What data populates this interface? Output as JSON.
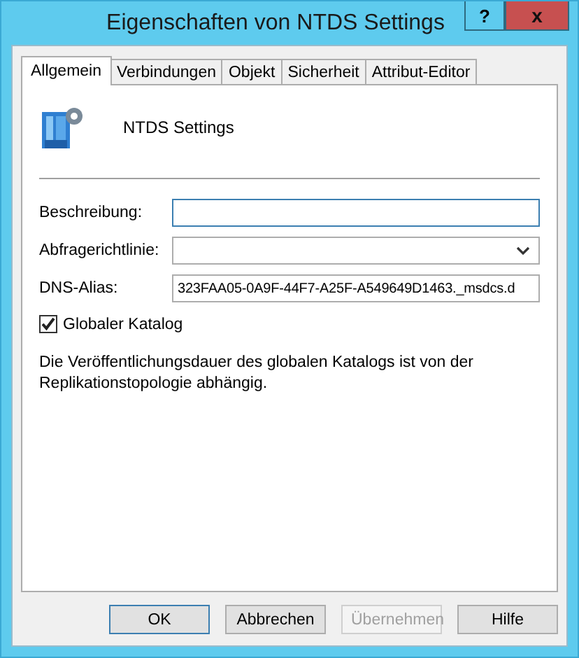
{
  "window": {
    "title": "Eigenschaften von NTDS Settings",
    "help": "?",
    "close": "x"
  },
  "tabs": [
    {
      "label": "Allgemein",
      "selected": true
    },
    {
      "label": "Verbindungen",
      "selected": false
    },
    {
      "label": "Objekt",
      "selected": false
    },
    {
      "label": "Sicherheit",
      "selected": false
    },
    {
      "label": "Attribut-Editor",
      "selected": false
    }
  ],
  "header": {
    "name": "NTDS Settings"
  },
  "fields": [
    {
      "kind": "text",
      "label": "Beschreibung:"
    },
    {
      "kind": "dropdown",
      "label": "Abfragerichtlinie:"
    },
    {
      "kind": "text",
      "label": "DNS-Alias:",
      "value": "323FAA05-0A9F-44F7-A25F-A549649D1463._msdcs.d"
    }
  ],
  "checkbox": {
    "label": "Globaler Katalog",
    "checked": true
  },
  "note": "Die Veröffentlichungsdauer des globalen Katalogs ist von der Replikationstopologie abhängig.",
  "buttons": [
    {
      "label": "OK",
      "disabled": false,
      "default": true
    },
    {
      "label": "Abbrechen",
      "disabled": false,
      "default": false
    },
    {
      "label": "Übernehmen",
      "disabled": true,
      "default": false
    },
    {
      "label": "Hilfe",
      "disabled": false,
      "default": false
    }
  ]
}
